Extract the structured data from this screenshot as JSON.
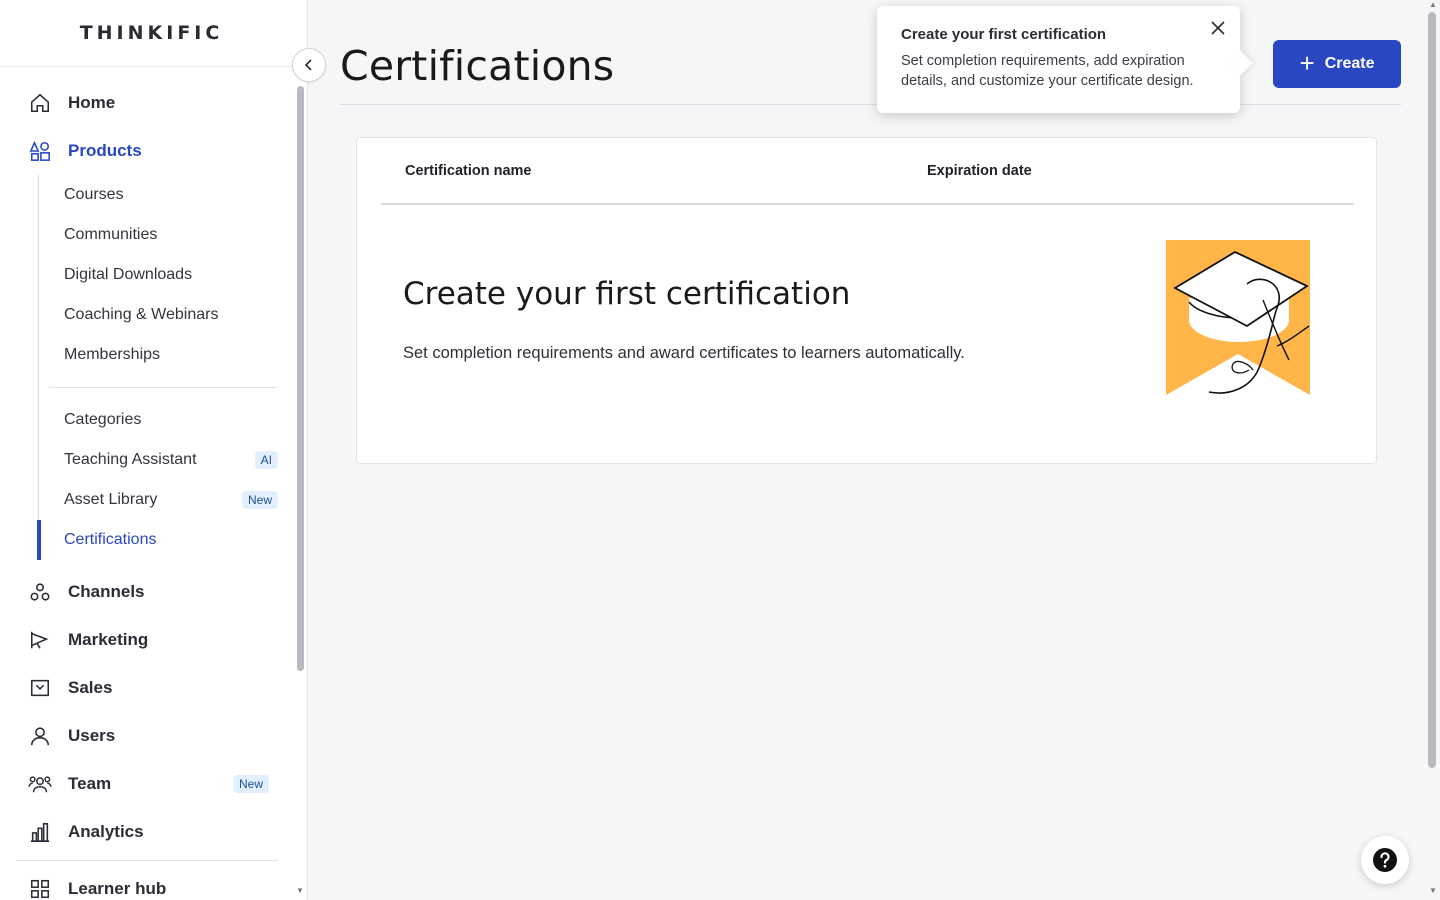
{
  "app": {
    "logo": "THINKIFIC"
  },
  "sidebar": {
    "main_items": [
      {
        "label": "Home",
        "icon": "home-icon"
      },
      {
        "label": "Products",
        "icon": "products-icon"
      }
    ],
    "product_items": [
      {
        "label": "Courses"
      },
      {
        "label": "Communities"
      },
      {
        "label": "Digital Downloads"
      },
      {
        "label": "Coaching & Webinars"
      },
      {
        "label": "Memberships"
      }
    ],
    "product_items_2": [
      {
        "label": "Categories",
        "badge": ""
      },
      {
        "label": "Teaching Assistant",
        "badge": "AI"
      },
      {
        "label": "Asset Library",
        "badge": "New"
      },
      {
        "label": "Certifications",
        "badge": ""
      }
    ],
    "lower_items": [
      {
        "label": "Channels",
        "icon": "channels-icon",
        "badge": ""
      },
      {
        "label": "Marketing",
        "icon": "megaphone-icon",
        "badge": ""
      },
      {
        "label": "Sales",
        "icon": "sales-icon",
        "badge": ""
      },
      {
        "label": "Users",
        "icon": "user-icon",
        "badge": ""
      },
      {
        "label": "Team",
        "icon": "team-icon",
        "badge": "New"
      },
      {
        "label": "Analytics",
        "icon": "analytics-icon",
        "badge": ""
      }
    ],
    "bottom_item": {
      "label": "Learner hub",
      "icon": "grid-icon"
    }
  },
  "header": {
    "title": "Certifications",
    "create_label": "Create"
  },
  "popover": {
    "title": "Create your first certification",
    "body": "Set completion requirements, add expiration details, and customize your certificate design."
  },
  "table": {
    "columns": [
      "Certification name",
      "Expiration date"
    ]
  },
  "empty_state": {
    "title": "Create your first certification",
    "description": "Set completion requirements and award certificates to learners automatically."
  },
  "colors": {
    "accent": "#2a47c2",
    "illustration": "#ffb547"
  }
}
